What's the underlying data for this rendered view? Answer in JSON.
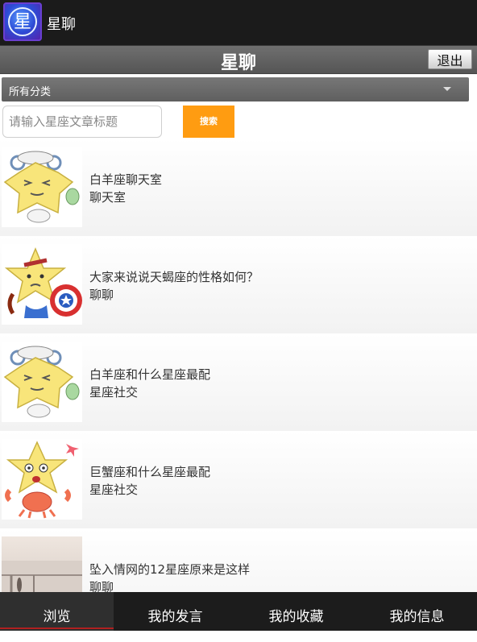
{
  "app": {
    "title": "星聊",
    "icon_glyph": "星"
  },
  "header": {
    "title": "星聊",
    "logout_label": "退出"
  },
  "category": {
    "selected": "所有分类"
  },
  "search": {
    "placeholder": "请输入星座文章标题",
    "value": "",
    "button_label": "搜索"
  },
  "items": [
    {
      "title": "白羊座聊天室",
      "category": "聊天室",
      "thumb": "aries-cartoon"
    },
    {
      "title": "大家来说说天蝎座的性格如何？",
      "category": "聊聊",
      "thumb": "scorpio-cartoon"
    },
    {
      "title": "白羊座和什么星座最配",
      "category": "星座社交",
      "thumb": "aries-cartoon"
    },
    {
      "title": "巨蟹座和什么星座最配",
      "category": "星座社交",
      "thumb": "cancer-cartoon"
    },
    {
      "title": "坠入情网的12星座原来是这样",
      "category": "聊聊",
      "thumb": "photo"
    }
  ],
  "tabs": [
    {
      "label": "浏览",
      "active": true
    },
    {
      "label": "我的发言",
      "active": false
    },
    {
      "label": "我的收藏",
      "active": false
    },
    {
      "label": "我的信息",
      "active": false
    }
  ]
}
